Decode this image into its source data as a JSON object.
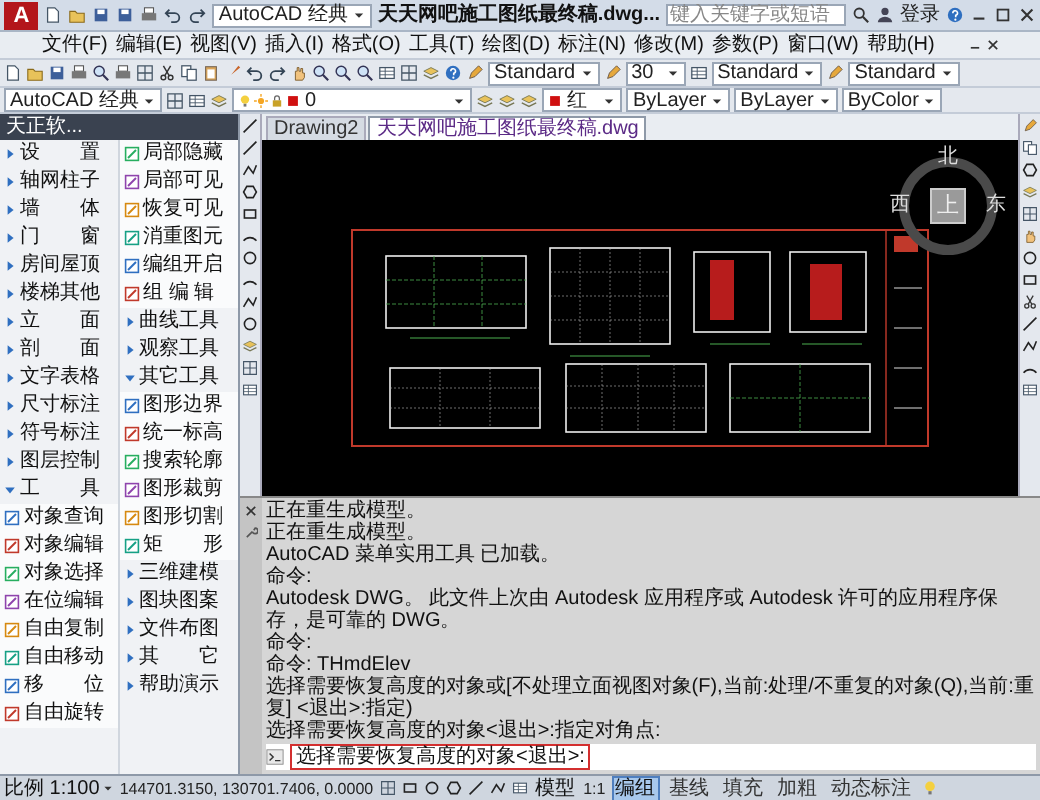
{
  "title_bar": {
    "app_button": "A",
    "workspace": "AutoCAD 经典",
    "title": "天天网吧施工图纸最终稿.dwg...",
    "search": {
      "placeholder": "键入关键字或短语"
    },
    "user": "登录"
  },
  "menu": [
    "文件(F)",
    "编辑(E)",
    "视图(V)",
    "插入(I)",
    "格式(O)",
    "工具(T)",
    "绘图(D)",
    "标注(N)",
    "修改(M)",
    "参数(P)",
    "窗口(W)",
    "帮助(H)"
  ],
  "style_toolbar": {
    "text_style": "Standard",
    "dim_style": "30",
    "table_style": "Standard",
    "multileader_style": "Standard"
  },
  "properties_toolbar": {
    "workspace": "AutoCAD 经典",
    "layer": "0",
    "color_setting": "红",
    "linetype": "ByLayer",
    "lineweight": "ByLayer",
    "plot_style": "ByColor"
  },
  "palette": {
    "title": "天正软...",
    "groups": [
      {
        "label": "设　　置",
        "expanded": false
      },
      {
        "label": "轴网柱子",
        "expanded": false
      },
      {
        "label": "墙　　体",
        "expanded": false
      },
      {
        "label": "门　　窗",
        "expanded": false
      },
      {
        "label": "房间屋顶",
        "expanded": false
      },
      {
        "label": "楼梯其他",
        "expanded": false
      },
      {
        "label": "立　　面",
        "expanded": false
      },
      {
        "label": "剖　　面",
        "expanded": false
      },
      {
        "label": "文字表格",
        "expanded": false
      },
      {
        "label": "尺寸标注",
        "expanded": false
      },
      {
        "label": "符号标注",
        "expanded": false
      },
      {
        "label": "图层控制",
        "expanded": false
      },
      {
        "label": "工　　具",
        "expanded": true,
        "children": [
          {
            "label": "对象查询"
          },
          {
            "label": "对象编辑"
          },
          {
            "label": "对象选择"
          },
          {
            "label": "在位编辑"
          },
          {
            "label": "自由复制"
          },
          {
            "label": "自由移动"
          },
          {
            "label": "移　　位"
          },
          {
            "label": "自由旋转"
          },
          {
            "label": "局部隐藏"
          },
          {
            "label": "局部可见"
          },
          {
            "label": "恢复可见"
          },
          {
            "label": "消重图元"
          },
          {
            "label": "编组开启"
          },
          {
            "label": "组 编 辑"
          }
        ]
      },
      {
        "label": "曲线工具",
        "expanded": false
      },
      {
        "label": "观察工具",
        "expanded": false
      },
      {
        "label": "其它工具",
        "expanded": true,
        "children": [
          {
            "label": "图形边界"
          },
          {
            "label": "统一标高"
          },
          {
            "label": "搜索轮廓"
          },
          {
            "label": "图形裁剪"
          },
          {
            "label": "图形切割"
          },
          {
            "label": "矩　　形"
          }
        ]
      },
      {
        "label": "三维建模",
        "expanded": false
      },
      {
        "label": "图块图案",
        "expanded": false
      },
      {
        "label": "文件布图",
        "expanded": false
      },
      {
        "label": "其　　它",
        "expanded": false
      },
      {
        "label": "帮助演示",
        "expanded": false
      }
    ]
  },
  "drawing_tabs": [
    {
      "label": "Drawing2",
      "selected": false
    },
    {
      "label": "天天网吧施工图纸最终稿.dwg",
      "selected": true
    }
  ],
  "viewcube": {
    "north": "北",
    "west": "西",
    "east": "东",
    "top": "上"
  },
  "command": {
    "lines": [
      "正在重生成模型。",
      "正在重生成模型。",
      "AutoCAD 菜单实用工具 已加载。",
      "命令:",
      "Autodesk DWG。 此文件上次由 Autodesk 应用程序或 Autodesk 许可的应用程序保存，是可靠的 DWG。",
      "命令:",
      "命令: THmdElev",
      "选择需要恢复高度的对象或[不处理立面视图对象(F),当前:处理/不重复的对象(Q),当前:重复] <退出>:指定)",
      "选择需要恢复高度的对象<退出>:指定对角点:"
    ],
    "prompt": "选择需要恢复高度的对象<退出>:"
  },
  "status_bar": {
    "scale": "比例 1:100",
    "coordinates": "144701.3150, 130701.7406, 0.0000",
    "model": "模型",
    "annotation_scale": "1:1",
    "toggles": [
      {
        "label": "编组",
        "on": true
      },
      {
        "label": "基线",
        "on": false
      },
      {
        "label": "填充",
        "on": false
      },
      {
        "label": "加粗",
        "on": false
      },
      {
        "label": "动态标注",
        "on": false
      }
    ]
  }
}
